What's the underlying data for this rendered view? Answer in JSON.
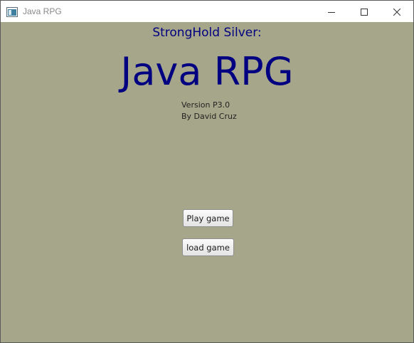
{
  "window": {
    "title": "Java RPG"
  },
  "header": {
    "subtitle": "StrongHold Silver:",
    "title": "Java RPG"
  },
  "info": {
    "version": "Version P3.0",
    "author": "By David Cruz"
  },
  "buttons": {
    "play": "Play game",
    "load": "load game"
  },
  "colors": {
    "background": "#a6a68a",
    "title_text": "#000080"
  },
  "icons": {
    "app": "java-window-icon",
    "minimize": "minimize-icon",
    "maximize": "maximize-icon",
    "close": "close-icon"
  }
}
